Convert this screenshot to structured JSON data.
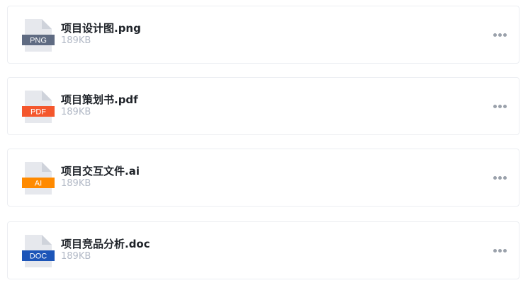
{
  "files": [
    {
      "name": "项目设计图.png",
      "size": "189KB",
      "type_label": "PNG",
      "icon": "png-file-icon",
      "badge_color": "#5f6b82"
    },
    {
      "name": "项目策划书.pdf",
      "size": "189KB",
      "type_label": "PDF",
      "icon": "pdf-file-icon",
      "badge_color": "#f4572d"
    },
    {
      "name": "项目交互文件.ai",
      "size": "189KB",
      "type_label": "AI",
      "icon": "ai-file-icon",
      "badge_color": "#ff8a00"
    },
    {
      "name": "项目竞品分析.doc",
      "size": "189KB",
      "type_label": "DOC",
      "icon": "doc-file-icon",
      "badge_color": "#1c55b8"
    }
  ],
  "more_icon": "more-horizontal-icon"
}
